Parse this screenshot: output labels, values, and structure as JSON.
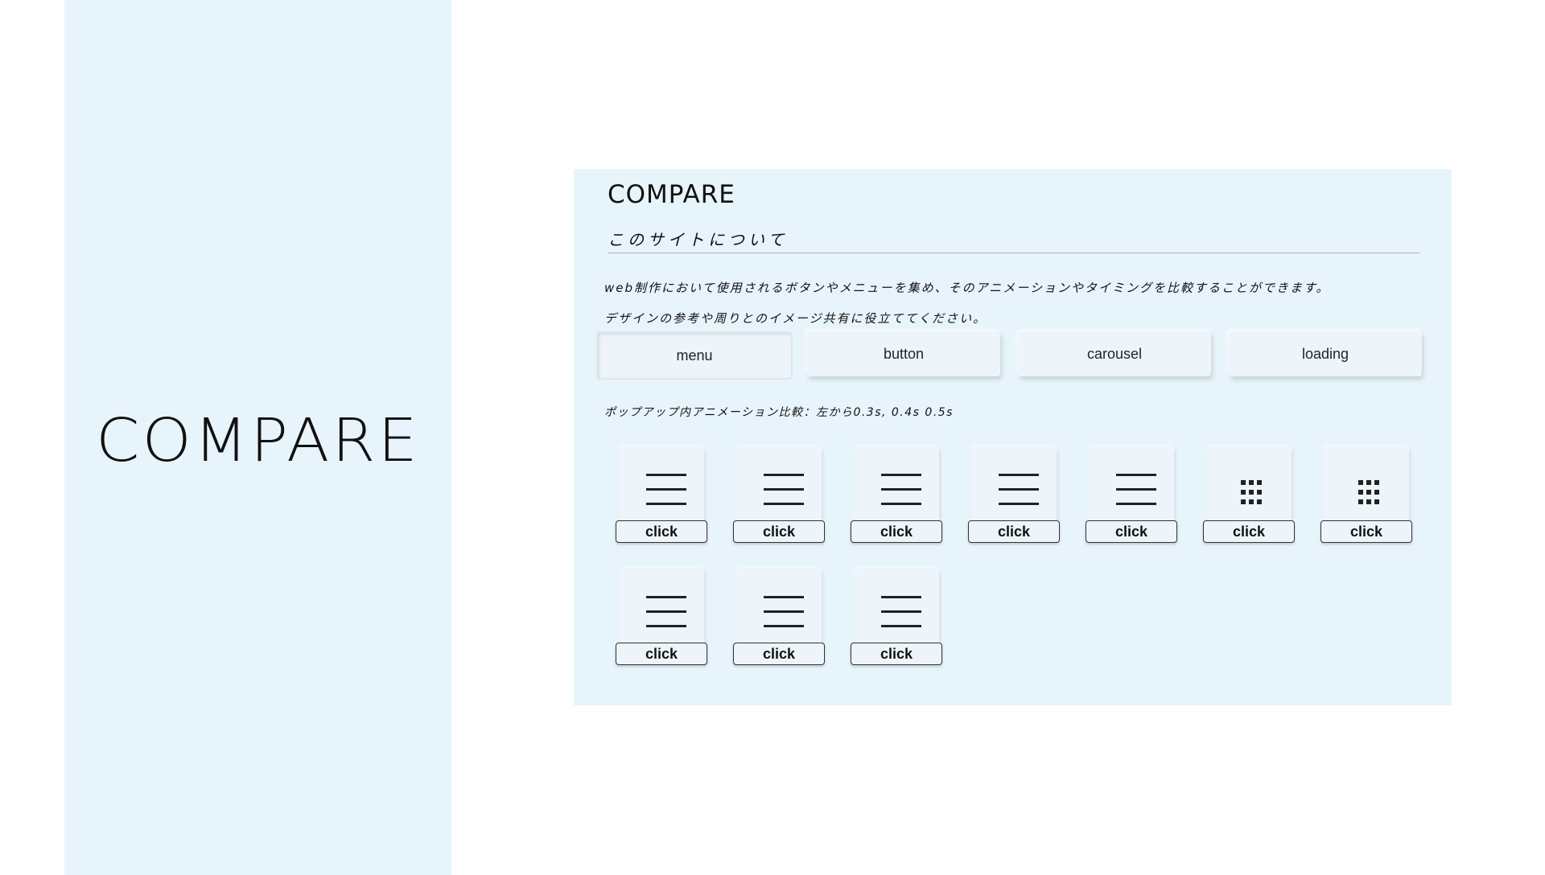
{
  "hero": {
    "title": "COMPARE"
  },
  "site": {
    "title": "COMPARE",
    "about_heading": "このサイトについて",
    "description_line1": "web制作において使用されるボタンやメニューを集め、そのアニメーションやタイミングを比較することができます。",
    "description_line2": "デザインの参考や周りとのイメージ共有に役立ててください。"
  },
  "tabs": [
    {
      "label": "menu",
      "active": true
    },
    {
      "label": "button",
      "active": false
    },
    {
      "label": "carousel",
      "active": false
    },
    {
      "label": "loading",
      "active": false
    }
  ],
  "section_note": "ポップアップ内アニメーション比較：左から0.3s, 0.4s 0.5s",
  "tiles": [
    {
      "icon": "hamburger-icon",
      "button_label": "click"
    },
    {
      "icon": "hamburger-icon",
      "button_label": "click"
    },
    {
      "icon": "hamburger-icon",
      "button_label": "click"
    },
    {
      "icon": "hamburger-icon",
      "button_label": "click"
    },
    {
      "icon": "hamburger-icon",
      "button_label": "click"
    },
    {
      "icon": "grid-icon",
      "button_label": "click"
    },
    {
      "icon": "grid-icon",
      "button_label": "click"
    },
    {
      "icon": "hamburger-icon",
      "button_label": "click"
    },
    {
      "icon": "hamburger-icon",
      "button_label": "click"
    },
    {
      "icon": "hamburger-icon",
      "button_label": "click"
    }
  ],
  "colors": {
    "panel_background": "#e8f4fb",
    "page_background": "#ffffff",
    "text": "#111111"
  }
}
